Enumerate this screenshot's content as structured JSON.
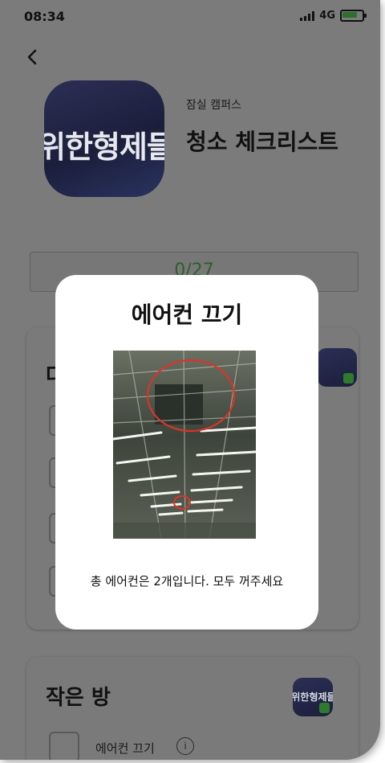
{
  "status_bar": {
    "time": "08:34",
    "network": "4G",
    "battery_level": 0.8
  },
  "header": {
    "campus": "잠실 캠퍼스",
    "title": "청소 체크리스트",
    "logo_text": "위한형제들"
  },
  "progress": {
    "text": "0/27"
  },
  "section1": {
    "title_partial": "다"
  },
  "section2": {
    "title": "작은 방",
    "items": [
      {
        "label": "에어컨 끄기"
      }
    ]
  },
  "modal": {
    "title": "에어컨 끄기",
    "description": "총 에어컨은 2개입니다. 모두 꺼주세요"
  },
  "colors": {
    "accent_green": "#2f7a2f",
    "overlay": "#7b7b7b",
    "modal_bg": "#ffffff"
  },
  "icons": {
    "back": "chevron-left-icon",
    "info": "info-icon"
  }
}
